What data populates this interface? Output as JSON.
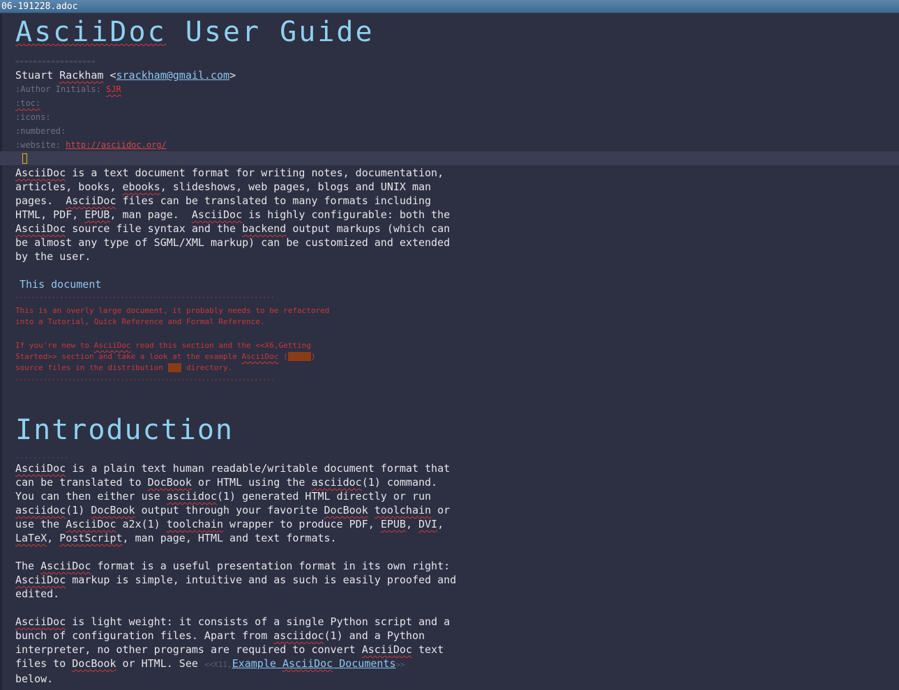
{
  "window": {
    "title": "06-191228.adoc"
  },
  "document": {
    "title_rule": "==================",
    "author": {
      "name_prefix": "Stuart ",
      "name_surname": "Rackham",
      "email_open": " <",
      "email": "srackham@gmail.com",
      "email_close": ">"
    },
    "attributes": [
      {
        "key": ":Author Initials: ",
        "value": "SJR"
      },
      {
        "key": ":toc:",
        "value": ""
      },
      {
        "key": ":icons:",
        "value": ""
      },
      {
        "key": ":numbered:",
        "value": ""
      },
      {
        "key": ":website: ",
        "value": "http://asciidoc.org/"
      }
    ],
    "intro_paragraph": {
      "w_asciidoc": "AsciiDoc",
      "t1": " is a text document format for writing notes, documentation,\narticles, books, ",
      "w_ebooks": "ebooks",
      "t2": ", slideshows, web pages, blogs and UNIX man\npages.  ",
      "w_asciidoc2": "AsciiDoc",
      "t3": " files can be translated to many formats including\nHTML, PDF, ",
      "w_epub": "EPUB",
      "t4": ", man page.  ",
      "w_asciidoc3": "AsciiDoc",
      "t5": " is highly configurable: both the\n",
      "w_asciidoc4": "AsciiDoc",
      "t6": " source file syntax and the ",
      "w_backend": "backend",
      "t7": " output markups (which can\nbe almost any type of SGML/XML markup) can be customized and extended\nby the user."
    },
    "sidebar": {
      "title": "This document",
      "rule": "****************************************************************",
      "line1": "This is an overly large document, it probably needs to be refactored",
      "line2": "into a Tutorial, Quick Reference and Formal Reference.",
      "line3_a": "If you're new to ",
      "line3_w": "AsciiDoc",
      "line3_b": " read this section and the <<X6,Getting",
      "line4_a": "Started>> section and take a look at the example ",
      "line4_w": "AsciiDoc",
      "line4_b": " (",
      "line4_hl": "*.txt",
      "line4_c": ")",
      "line5_a": "source files in the distribution ",
      "line5_hl": "doc",
      "line5_b": " directory."
    },
    "section": {
      "title": "Introduction",
      "underline": "------------",
      "p1": {
        "w1": "AsciiDoc",
        "t1": " is a plain text human readable/writable document format that\ncan be translated to ",
        "w2": "DocBook",
        "t2": " or HTML using the ",
        "w3": "asciidoc",
        "t3": "(1) command.\nYou can then either use ",
        "w4": "asciidoc",
        "t4": "(1) generated HTML directly or run\n",
        "w5": "asciidoc",
        "t5": "(1) ",
        "w6": "DocBook",
        "t6": " output through your favorite ",
        "w7": "DocBook",
        "t7": " ",
        "w8": "toolchain",
        "t8": " or\nuse the ",
        "w9": "AsciiDoc",
        "t9": " a2x(1) ",
        "w10": "toolchain",
        "t10": " wrapper to produce PDF, ",
        "w11": "EPUB",
        "t11": ", ",
        "w12": "DVI",
        "t12": ",\n",
        "w13": "LaTeX",
        "t13": ", ",
        "w14": "PostScript",
        "t14": ", man page, HTML and text formats."
      },
      "p2": {
        "t1": "The ",
        "w1": "AsciiDoc",
        "t2": " format is a useful presentation format in its own right:\n",
        "w2": "AsciiDoc",
        "t3": " markup is simple, intuitive and as such is easily proofed and\nedited."
      },
      "p3": {
        "w1": "AsciiDoc",
        "t1": " is light weight: it consists of a single Python script and a\nbunch of configuration files. Apart from ",
        "w2": "asciidoc",
        "t2": "(1) and a Python\ninterpreter, no other programs are required to convert ",
        "w3": "AsciiDoc",
        "t3": " text\nfiles to ",
        "w4": "DocBook",
        "t4": " or HTML. See ",
        "xref_open": "<<X11,",
        "link_a": "Example ",
        "link_w": "AsciiDoc",
        "link_b": " Documents",
        "xref_close": ">>",
        "t5": "\nbelow."
      }
    }
  },
  "title": "AsciiDoc User Guide",
  "title_w": "AsciiDoc",
  "title_rest": " User Guide"
}
